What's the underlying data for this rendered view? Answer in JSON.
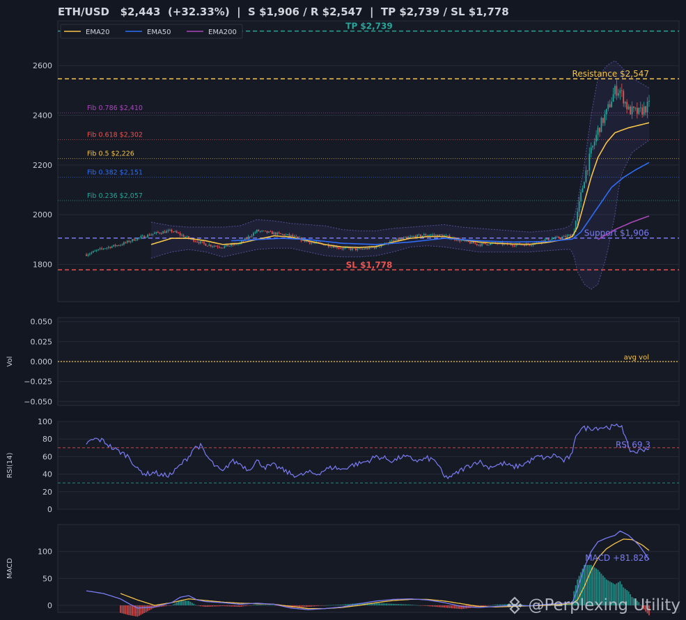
{
  "header": {
    "title": "ETH/USD   $2,443  (+32.33%)  |  S $1,906 / R $2,547  |  TP $2,739 / SL $1,778"
  },
  "watermark": {
    "text": "@Perplexing Utility",
    "icon": "binance-diamond-icon"
  },
  "colors": {
    "background": "#131722",
    "panel": "#161a25",
    "grid": "#262b38",
    "up": "#26a69a",
    "down": "#ef5350",
    "ema20": "#f7c548",
    "ema50": "#2f6df6",
    "ema200": "#ab47bc",
    "rsi": "#7b7cf5",
    "macd": "#7b7cf5",
    "signal": "#f7c548",
    "tp": "#26a69a",
    "sl": "#ef5350",
    "resistance": "#f7c548",
    "support": "#7b7cf5"
  },
  "chart_data": [
    {
      "type": "candlestick",
      "ylim": [
        1650,
        2780
      ],
      "yticks": [
        1800,
        2000,
        2200,
        2400,
        2600
      ],
      "grid": true,
      "legend": {
        "position": "top-left",
        "entries": [
          "EMA20",
          "EMA50",
          "EMA200"
        ]
      },
      "n_bars": 300,
      "price_anchors": [
        [
          0,
          1840
        ],
        [
          10,
          1865
        ],
        [
          20,
          1880
        ],
        [
          30,
          1905
        ],
        [
          40,
          1925
        ],
        [
          50,
          1935
        ],
        [
          60,
          1905
        ],
        [
          70,
          1880
        ],
        [
          80,
          1870
        ],
        [
          90,
          1885
        ],
        [
          100,
          1935
        ],
        [
          110,
          1925
        ],
        [
          120,
          1915
        ],
        [
          130,
          1890
        ],
        [
          140,
          1880
        ],
        [
          150,
          1865
        ],
        [
          160,
          1860
        ],
        [
          170,
          1870
        ],
        [
          180,
          1895
        ],
        [
          190,
          1910
        ],
        [
          200,
          1920
        ],
        [
          210,
          1915
        ],
        [
          220,
          1895
        ],
        [
          230,
          1880
        ],
        [
          240,
          1885
        ],
        [
          250,
          1880
        ],
        [
          260,
          1880
        ],
        [
          270,
          1900
        ],
        [
          280,
          1910
        ],
        [
          285,
          1920
        ],
        [
          288,
          2000
        ],
        [
          292,
          2150
        ],
        [
          296,
          2250
        ],
        [
          300,
          2340
        ],
        [
          305,
          2410
        ],
        [
          310,
          2500
        ],
        [
          313,
          2500
        ],
        [
          318,
          2420
        ],
        [
          324,
          2410
        ],
        [
          330,
          2440
        ]
      ],
      "ema20": [
        [
          38,
          1880
        ],
        [
          50,
          1905
        ],
        [
          60,
          1905
        ],
        [
          70,
          1895
        ],
        [
          80,
          1880
        ],
        [
          90,
          1885
        ],
        [
          100,
          1900
        ],
        [
          110,
          1915
        ],
        [
          120,
          1910
        ],
        [
          130,
          1895
        ],
        [
          140,
          1880
        ],
        [
          150,
          1870
        ],
        [
          160,
          1868
        ],
        [
          170,
          1872
        ],
        [
          180,
          1890
        ],
        [
          190,
          1905
        ],
        [
          200,
          1912
        ],
        [
          210,
          1912
        ],
        [
          220,
          1900
        ],
        [
          230,
          1890
        ],
        [
          240,
          1885
        ],
        [
          250,
          1882
        ],
        [
          260,
          1881
        ],
        [
          270,
          1888
        ],
        [
          280,
          1900
        ],
        [
          285,
          1912
        ],
        [
          288,
          1950
        ],
        [
          292,
          2050
        ],
        [
          296,
          2150
        ],
        [
          300,
          2230
        ],
        [
          305,
          2290
        ],
        [
          310,
          2330
        ],
        [
          318,
          2350
        ],
        [
          330,
          2370
        ]
      ],
      "ema50": [
        [
          85,
          1895
        ],
        [
          100,
          1900
        ],
        [
          115,
          1905
        ],
        [
          130,
          1900
        ],
        [
          150,
          1885
        ],
        [
          170,
          1880
        ],
        [
          190,
          1890
        ],
        [
          210,
          1905
        ],
        [
          230,
          1895
        ],
        [
          250,
          1890
        ],
        [
          270,
          1892
        ],
        [
          285,
          1902
        ],
        [
          290,
          1930
        ],
        [
          296,
          1990
        ],
        [
          302,
          2050
        ],
        [
          308,
          2110
        ],
        [
          315,
          2150
        ],
        [
          322,
          2180
        ],
        [
          330,
          2210
        ]
      ],
      "ema200": [
        [
          300,
          1900
        ],
        [
          310,
          1940
        ],
        [
          320,
          1970
        ],
        [
          330,
          1995
        ]
      ],
      "bb_anchors": [
        [
          38,
          1825,
          1970
        ],
        [
          50,
          1850,
          1955
        ],
        [
          60,
          1860,
          1950
        ],
        [
          70,
          1850,
          1950
        ],
        [
          80,
          1830,
          1950
        ],
        [
          90,
          1845,
          1955
        ],
        [
          100,
          1860,
          1980
        ],
        [
          110,
          1865,
          1975
        ],
        [
          120,
          1865,
          1965
        ],
        [
          130,
          1850,
          1960
        ],
        [
          140,
          1835,
          1955
        ],
        [
          150,
          1830,
          1940
        ],
        [
          160,
          1830,
          1935
        ],
        [
          170,
          1835,
          1935
        ],
        [
          180,
          1850,
          1945
        ],
        [
          190,
          1870,
          1950
        ],
        [
          200,
          1875,
          1955
        ],
        [
          210,
          1870,
          1960
        ],
        [
          220,
          1860,
          1950
        ],
        [
          230,
          1850,
          1945
        ],
        [
          240,
          1850,
          1940
        ],
        [
          250,
          1850,
          1935
        ],
        [
          260,
          1850,
          1930
        ],
        [
          270,
          1855,
          1935
        ],
        [
          280,
          1860,
          1945
        ],
        [
          285,
          1860,
          1960
        ],
        [
          288,
          1770,
          2050
        ],
        [
          292,
          1720,
          2200
        ],
        [
          296,
          1700,
          2400
        ],
        [
          300,
          1720,
          2550
        ],
        [
          305,
          1830,
          2600
        ],
        [
          310,
          2000,
          2620
        ],
        [
          313,
          2150,
          2600
        ],
        [
          320,
          2250,
          2550
        ],
        [
          330,
          2300,
          2510
        ]
      ],
      "levels": [
        {
          "name": "TP",
          "value": 2739,
          "label": "TP $2,739",
          "style": "dashed"
        },
        {
          "name": "Resistance",
          "value": 2547,
          "label": "Resistance $2,547",
          "style": "dashed"
        },
        {
          "name": "Support",
          "value": 1906,
          "label": "Support $1,906",
          "style": "dashed"
        },
        {
          "name": "SL",
          "value": 1778,
          "label": "SL $1,778",
          "style": "dashed"
        }
      ],
      "fibs": [
        {
          "label": "Fib 0.786 $2,410",
          "value": 2410,
          "color": "#ab47bc"
        },
        {
          "label": "Fib 0.618 $2,302",
          "value": 2302,
          "color": "#ef5350"
        },
        {
          "label": "Fib 0.5 $2,226",
          "value": 2226,
          "color": "#f7c548"
        },
        {
          "label": "Fib 0.382 $2,151",
          "value": 2151,
          "color": "#2f6df6"
        },
        {
          "label": "Fib 0.236 $2,057",
          "value": 2057,
          "color": "#26a69a"
        }
      ]
    },
    {
      "type": "line",
      "ylabel": "Vol",
      "ylim": [
        -0.055,
        0.055
      ],
      "yticks": [
        -0.05,
        -0.025,
        0,
        0.025,
        0.05
      ],
      "ytick_labels": [
        "−0.050",
        "−0.025",
        "0.000",
        "0.025",
        "0.050"
      ],
      "annotation": "avg vol",
      "avg_line_value": 0
    },
    {
      "type": "line",
      "ylabel": "RSI(14)",
      "ylim": [
        0,
        100
      ],
      "yticks": [
        0,
        20,
        40,
        60,
        80,
        100
      ],
      "overbought": 70,
      "oversold": 30,
      "label": "RSI 69.3",
      "rsi_anchors": [
        [
          0,
          75
        ],
        [
          5,
          80
        ],
        [
          10,
          78
        ],
        [
          15,
          70
        ],
        [
          20,
          65
        ],
        [
          25,
          60
        ],
        [
          30,
          45
        ],
        [
          35,
          40
        ],
        [
          40,
          42
        ],
        [
          45,
          38
        ],
        [
          50,
          40
        ],
        [
          55,
          50
        ],
        [
          60,
          60
        ],
        [
          63,
          70
        ],
        [
          67,
          72
        ],
        [
          70,
          62
        ],
        [
          75,
          50
        ],
        [
          80,
          42
        ],
        [
          85,
          55
        ],
        [
          90,
          52
        ],
        [
          95,
          45
        ],
        [
          100,
          55
        ],
        [
          105,
          48
        ],
        [
          110,
          50
        ],
        [
          115,
          45
        ],
        [
          120,
          40
        ],
        [
          125,
          38
        ],
        [
          130,
          42
        ],
        [
          135,
          40
        ],
        [
          140,
          45
        ],
        [
          145,
          48
        ],
        [
          150,
          45
        ],
        [
          155,
          50
        ],
        [
          160,
          52
        ],
        [
          165,
          55
        ],
        [
          170,
          60
        ],
        [
          175,
          58
        ],
        [
          180,
          55
        ],
        [
          185,
          60
        ],
        [
          190,
          58
        ],
        [
          195,
          55
        ],
        [
          200,
          58
        ],
        [
          205,
          55
        ],
        [
          210,
          36
        ],
        [
          215,
          38
        ],
        [
          220,
          45
        ],
        [
          225,
          50
        ],
        [
          230,
          55
        ],
        [
          235,
          48
        ],
        [
          240,
          50
        ],
        [
          245,
          52
        ],
        [
          250,
          48
        ],
        [
          255,
          50
        ],
        [
          260,
          55
        ],
        [
          265,
          60
        ],
        [
          270,
          58
        ],
        [
          275,
          62
        ],
        [
          280,
          55
        ],
        [
          285,
          62
        ],
        [
          287,
          85
        ],
        [
          290,
          92
        ],
        [
          300,
          93
        ],
        [
          310,
          94
        ],
        [
          314,
          96
        ],
        [
          318,
          68
        ],
        [
          322,
          65
        ],
        [
          326,
          68
        ],
        [
          330,
          70
        ]
      ]
    },
    {
      "type": "bar+line",
      "ylabel": "MACD",
      "ylim": [
        -13,
        150
      ],
      "yticks": [
        0,
        50,
        100
      ],
      "label": "MACD +81.826",
      "macd_anchors": [
        [
          0,
          27
        ],
        [
          10,
          22
        ],
        [
          20,
          12
        ],
        [
          25,
          3
        ],
        [
          30,
          -5
        ],
        [
          40,
          -3
        ],
        [
          50,
          5
        ],
        [
          55,
          15
        ],
        [
          60,
          18
        ],
        [
          65,
          10
        ],
        [
          70,
          7
        ],
        [
          80,
          5
        ],
        [
          90,
          2
        ],
        [
          100,
          4
        ],
        [
          110,
          2
        ],
        [
          120,
          -5
        ],
        [
          130,
          -8
        ],
        [
          140,
          -6
        ],
        [
          150,
          -3
        ],
        [
          160,
          3
        ],
        [
          170,
          8
        ],
        [
          180,
          11
        ],
        [
          190,
          12
        ],
        [
          200,
          10
        ],
        [
          210,
          5
        ],
        [
          220,
          -2
        ],
        [
          230,
          -4
        ],
        [
          240,
          -2
        ],
        [
          250,
          0
        ],
        [
          260,
          -1
        ],
        [
          270,
          2
        ],
        [
          280,
          4
        ],
        [
          285,
          5
        ],
        [
          288,
          30
        ],
        [
          292,
          70
        ],
        [
          296,
          100
        ],
        [
          300,
          118
        ],
        [
          305,
          125
        ],
        [
          310,
          130
        ],
        [
          313,
          138
        ],
        [
          318,
          130
        ],
        [
          324,
          112
        ],
        [
          330,
          85
        ]
      ],
      "signal_anchors": [
        [
          20,
          22
        ],
        [
          30,
          10
        ],
        [
          40,
          0
        ],
        [
          50,
          5
        ],
        [
          60,
          12
        ],
        [
          70,
          9
        ],
        [
          80,
          6
        ],
        [
          90,
          4
        ],
        [
          100,
          3
        ],
        [
          110,
          2
        ],
        [
          120,
          -2
        ],
        [
          130,
          -6
        ],
        [
          140,
          -6
        ],
        [
          150,
          -4
        ],
        [
          160,
          0
        ],
        [
          170,
          5
        ],
        [
          180,
          9
        ],
        [
          190,
          11
        ],
        [
          200,
          11
        ],
        [
          210,
          8
        ],
        [
          220,
          3
        ],
        [
          230,
          -2
        ],
        [
          240,
          -3
        ],
        [
          250,
          -2
        ],
        [
          260,
          -1
        ],
        [
          270,
          0
        ],
        [
          280,
          2
        ],
        [
          285,
          3
        ],
        [
          288,
          10
        ],
        [
          292,
          35
        ],
        [
          296,
          65
        ],
        [
          300,
          88
        ],
        [
          305,
          105
        ],
        [
          310,
          115
        ],
        [
          315,
          123
        ],
        [
          320,
          122
        ],
        [
          326,
          112
        ],
        [
          330,
          102
        ]
      ]
    }
  ]
}
